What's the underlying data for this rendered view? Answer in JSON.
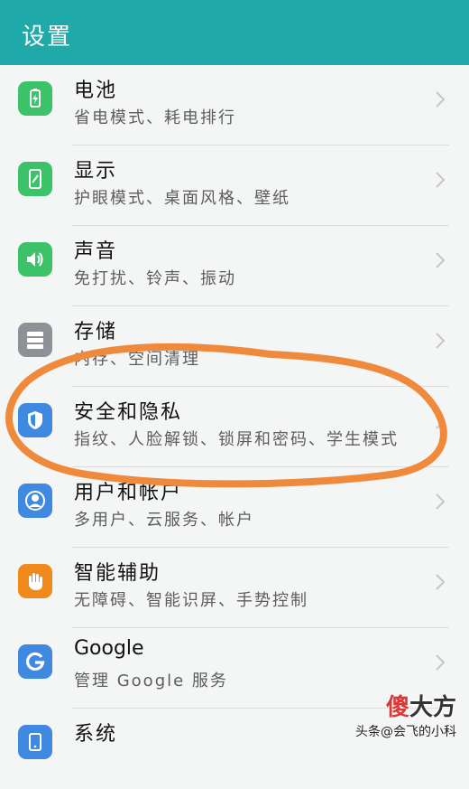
{
  "header": {
    "title": "设置"
  },
  "items": [
    {
      "title": "电池",
      "subtitle": "省电模式、耗电排行",
      "icon": "battery-icon",
      "color": "#3cc36a"
    },
    {
      "title": "显示",
      "subtitle": "护眼模式、桌面风格、壁纸",
      "icon": "display-icon",
      "color": "#3cc36a"
    },
    {
      "title": "声音",
      "subtitle": "免打扰、铃声、振动",
      "icon": "speaker-icon",
      "color": "#3cc36a"
    },
    {
      "title": "存储",
      "subtitle": "内存、空间清理",
      "icon": "storage-icon",
      "color": "#8e9196"
    },
    {
      "title": "安全和隐私",
      "subtitle": "指纹、人脸解锁、锁屏和密码、学生模式",
      "icon": "shield-icon",
      "color": "#3f8ae0"
    },
    {
      "title": "用户和帐户",
      "subtitle": "多用户、云服务、帐户",
      "icon": "user-icon",
      "color": "#3f8ae0"
    },
    {
      "title": "智能辅助",
      "subtitle": "无障碍、智能识屏、手势控制",
      "icon": "hand-icon",
      "color": "#f08a1c"
    },
    {
      "title": "Google",
      "subtitle": "管理 Google 服务",
      "icon": "google-icon",
      "color": "#3f8ae0"
    },
    {
      "title": "系统",
      "subtitle": "",
      "icon": "system-icon",
      "color": "#3f8ae0"
    }
  ],
  "annotation": {
    "color": "#ef8a3c"
  },
  "watermark": {
    "brand_first": "傻",
    "brand_rest": "大方",
    "source": "头条@会飞的小科"
  }
}
